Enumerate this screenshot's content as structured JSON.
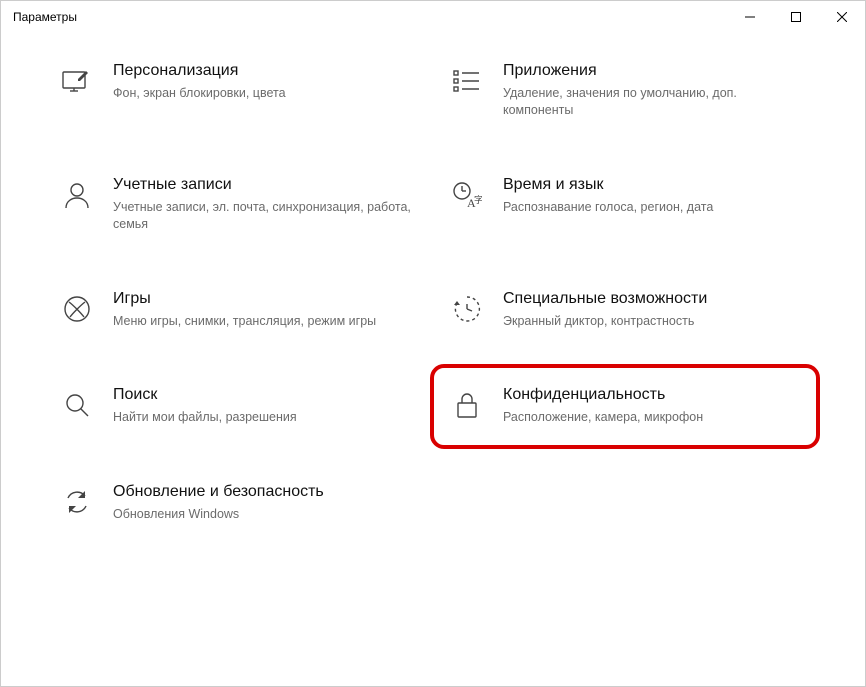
{
  "window": {
    "title": "Параметры"
  },
  "tiles": {
    "personalization": {
      "title": "Персонализация",
      "desc": "Фон, экран блокировки, цвета"
    },
    "apps": {
      "title": "Приложения",
      "desc": "Удаление, значения по умолчанию, доп. компоненты"
    },
    "accounts": {
      "title": "Учетные записи",
      "desc": "Учетные записи, эл. почта, синхронизация, работа, семья"
    },
    "timelang": {
      "title": "Время и язык",
      "desc": "Распознавание голоса, регион, дата"
    },
    "gaming": {
      "title": "Игры",
      "desc": "Меню игры, снимки, трансляция, режим игры"
    },
    "ease": {
      "title": "Специальные возможности",
      "desc": "Экранный диктор, контрастность"
    },
    "search": {
      "title": "Поиск",
      "desc": "Найти мои файлы, разрешения"
    },
    "privacy": {
      "title": "Конфиденциальность",
      "desc": "Расположение, камера, микрофон"
    },
    "update": {
      "title": "Обновление и безопасность",
      "desc": "Обновления Windows"
    }
  }
}
